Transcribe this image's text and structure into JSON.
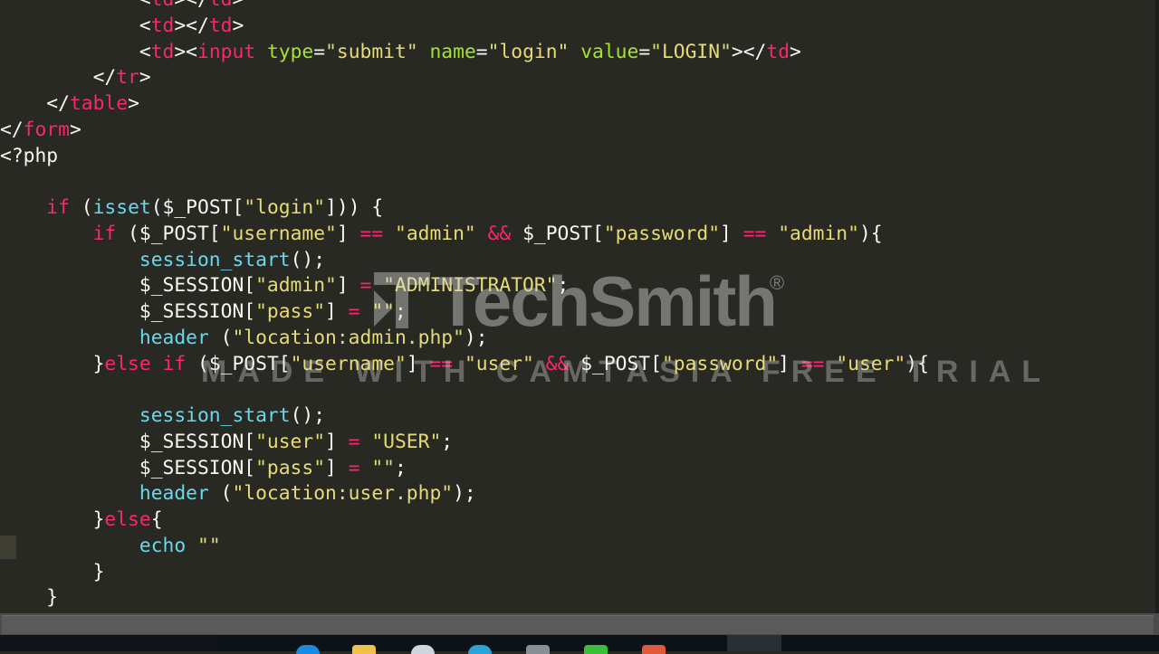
{
  "code_lines": [
    [
      {
        "t": "            ",
        "c": "plain"
      },
      {
        "t": "<",
        "c": "plain"
      },
      {
        "t": "td",
        "c": "tag"
      },
      {
        "t": "></",
        "c": "plain"
      },
      {
        "t": "td",
        "c": "tag"
      },
      {
        "t": ">",
        "c": "plain"
      }
    ],
    [
      {
        "t": "            ",
        "c": "plain"
      },
      {
        "t": "<",
        "c": "plain"
      },
      {
        "t": "td",
        "c": "tag"
      },
      {
        "t": "></",
        "c": "plain"
      },
      {
        "t": "td",
        "c": "tag"
      },
      {
        "t": ">",
        "c": "plain"
      }
    ],
    [
      {
        "t": "            ",
        "c": "plain"
      },
      {
        "t": "<",
        "c": "plain"
      },
      {
        "t": "td",
        "c": "tag"
      },
      {
        "t": "><",
        "c": "plain"
      },
      {
        "t": "input",
        "c": "tag"
      },
      {
        "t": " ",
        "c": "plain"
      },
      {
        "t": "type",
        "c": "attr"
      },
      {
        "t": "=",
        "c": "plain"
      },
      {
        "t": "\"submit\"",
        "c": "str"
      },
      {
        "t": " ",
        "c": "plain"
      },
      {
        "t": "name",
        "c": "attr"
      },
      {
        "t": "=",
        "c": "plain"
      },
      {
        "t": "\"login\"",
        "c": "str"
      },
      {
        "t": " ",
        "c": "plain"
      },
      {
        "t": "value",
        "c": "attr"
      },
      {
        "t": "=",
        "c": "plain"
      },
      {
        "t": "\"LOGIN\"",
        "c": "str"
      },
      {
        "t": "></",
        "c": "plain"
      },
      {
        "t": "td",
        "c": "tag"
      },
      {
        "t": ">",
        "c": "plain"
      }
    ],
    [
      {
        "t": "        ",
        "c": "plain"
      },
      {
        "t": "</",
        "c": "plain"
      },
      {
        "t": "tr",
        "c": "tag"
      },
      {
        "t": ">",
        "c": "plain"
      }
    ],
    [
      {
        "t": "    ",
        "c": "plain"
      },
      {
        "t": "</",
        "c": "plain"
      },
      {
        "t": "table",
        "c": "tag"
      },
      {
        "t": ">",
        "c": "plain"
      }
    ],
    [
      {
        "t": "</",
        "c": "plain"
      },
      {
        "t": "form",
        "c": "tag"
      },
      {
        "t": ">",
        "c": "plain"
      }
    ],
    [
      {
        "t": "<?php",
        "c": "plain"
      }
    ],
    [
      {
        "t": "",
        "c": "plain"
      }
    ],
    [
      {
        "t": "    ",
        "c": "plain"
      },
      {
        "t": "if",
        "c": "kw"
      },
      {
        "t": " (",
        "c": "plain"
      },
      {
        "t": "isset",
        "c": "fn"
      },
      {
        "t": "($_POST[",
        "c": "plain"
      },
      {
        "t": "\"login\"",
        "c": "str"
      },
      {
        "t": "])) {",
        "c": "plain"
      }
    ],
    [
      {
        "t": "        ",
        "c": "plain"
      },
      {
        "t": "if",
        "c": "kw"
      },
      {
        "t": " ($_POST[",
        "c": "plain"
      },
      {
        "t": "\"username\"",
        "c": "str"
      },
      {
        "t": "] ",
        "c": "plain"
      },
      {
        "t": "==",
        "c": "kw"
      },
      {
        "t": " ",
        "c": "plain"
      },
      {
        "t": "\"admin\"",
        "c": "str"
      },
      {
        "t": " ",
        "c": "plain"
      },
      {
        "t": "&&",
        "c": "kw"
      },
      {
        "t": " $_POST[",
        "c": "plain"
      },
      {
        "t": "\"password\"",
        "c": "str"
      },
      {
        "t": "] ",
        "c": "plain"
      },
      {
        "t": "==",
        "c": "kw"
      },
      {
        "t": " ",
        "c": "plain"
      },
      {
        "t": "\"admin\"",
        "c": "str"
      },
      {
        "t": "){",
        "c": "plain"
      }
    ],
    [
      {
        "t": "            ",
        "c": "plain"
      },
      {
        "t": "session_start",
        "c": "fn"
      },
      {
        "t": "();",
        "c": "plain"
      }
    ],
    [
      {
        "t": "            ",
        "c": "plain"
      },
      {
        "t": "$_SESSION[",
        "c": "plain"
      },
      {
        "t": "\"admin\"",
        "c": "str"
      },
      {
        "t": "] ",
        "c": "plain"
      },
      {
        "t": "=",
        "c": "kw"
      },
      {
        "t": " ",
        "c": "plain"
      },
      {
        "t": "\"ADMINISTRATOR\"",
        "c": "str"
      },
      {
        "t": ";",
        "c": "plain"
      }
    ],
    [
      {
        "t": "            ",
        "c": "plain"
      },
      {
        "t": "$_SESSION[",
        "c": "plain"
      },
      {
        "t": "\"pass\"",
        "c": "str"
      },
      {
        "t": "] ",
        "c": "plain"
      },
      {
        "t": "=",
        "c": "kw"
      },
      {
        "t": " ",
        "c": "plain"
      },
      {
        "t": "\"\"",
        "c": "str"
      },
      {
        "t": ";",
        "c": "plain"
      }
    ],
    [
      {
        "t": "            ",
        "c": "plain"
      },
      {
        "t": "header",
        "c": "fn"
      },
      {
        "t": " (",
        "c": "plain"
      },
      {
        "t": "\"location:admin.php\"",
        "c": "str"
      },
      {
        "t": ");",
        "c": "plain"
      }
    ],
    [
      {
        "t": "        ",
        "c": "plain"
      },
      {
        "t": "}",
        "c": "plain"
      },
      {
        "t": "else",
        "c": "kw"
      },
      {
        "t": " ",
        "c": "plain"
      },
      {
        "t": "if",
        "c": "kw"
      },
      {
        "t": " ($_POST[",
        "c": "plain"
      },
      {
        "t": "\"username\"",
        "c": "str"
      },
      {
        "t": "] ",
        "c": "plain"
      },
      {
        "t": "==",
        "c": "kw"
      },
      {
        "t": " ",
        "c": "plain"
      },
      {
        "t": "\"user\"",
        "c": "str"
      },
      {
        "t": " ",
        "c": "plain"
      },
      {
        "t": "&&",
        "c": "kw"
      },
      {
        "t": " $_POST[",
        "c": "plain"
      },
      {
        "t": "\"password\"",
        "c": "str"
      },
      {
        "t": "] ",
        "c": "plain"
      },
      {
        "t": "==",
        "c": "kw"
      },
      {
        "t": " ",
        "c": "plain"
      },
      {
        "t": "\"user\"",
        "c": "str"
      },
      {
        "t": "){",
        "c": "plain"
      }
    ],
    [
      {
        "t": "",
        "c": "plain"
      }
    ],
    [
      {
        "t": "            ",
        "c": "plain"
      },
      {
        "t": "session_start",
        "c": "fn"
      },
      {
        "t": "();",
        "c": "plain"
      }
    ],
    [
      {
        "t": "            ",
        "c": "plain"
      },
      {
        "t": "$_SESSION[",
        "c": "plain"
      },
      {
        "t": "\"user\"",
        "c": "str"
      },
      {
        "t": "] ",
        "c": "plain"
      },
      {
        "t": "=",
        "c": "kw"
      },
      {
        "t": " ",
        "c": "plain"
      },
      {
        "t": "\"USER\"",
        "c": "str"
      },
      {
        "t": ";",
        "c": "plain"
      }
    ],
    [
      {
        "t": "            ",
        "c": "plain"
      },
      {
        "t": "$_SESSION[",
        "c": "plain"
      },
      {
        "t": "\"pass\"",
        "c": "str"
      },
      {
        "t": "] ",
        "c": "plain"
      },
      {
        "t": "=",
        "c": "kw"
      },
      {
        "t": " ",
        "c": "plain"
      },
      {
        "t": "\"\"",
        "c": "str"
      },
      {
        "t": ";",
        "c": "plain"
      }
    ],
    [
      {
        "t": "            ",
        "c": "plain"
      },
      {
        "t": "header",
        "c": "fn"
      },
      {
        "t": " (",
        "c": "plain"
      },
      {
        "t": "\"location:user.php\"",
        "c": "str"
      },
      {
        "t": ");",
        "c": "plain"
      }
    ],
    [
      {
        "t": "        ",
        "c": "plain"
      },
      {
        "t": "}",
        "c": "plain"
      },
      {
        "t": "else",
        "c": "kw"
      },
      {
        "t": "{",
        "c": "plain"
      }
    ],
    [
      {
        "t": "            ",
        "c": "plain"
      },
      {
        "t": "echo",
        "c": "fn"
      },
      {
        "t": " ",
        "c": "plain"
      },
      {
        "t": "\"\"",
        "c": "str"
      }
    ],
    [
      {
        "t": "        ",
        "c": "plain"
      },
      {
        "t": "}",
        "c": "plain"
      }
    ],
    [
      {
        "t": "    ",
        "c": "plain"
      },
      {
        "t": "}",
        "c": "plain"
      }
    ]
  ],
  "watermark": {
    "brand": "TechSmith",
    "registered": "®",
    "made_with": "MADE WITH CAMTASIA FREE TRIAL"
  },
  "colors": {
    "background": "#282923",
    "tag": "#f92672",
    "attr": "#a6e22e",
    "string": "#e6db74",
    "function": "#66d9ef",
    "plain": "#f8f8f2"
  },
  "taskbar_icons": [
    "edge-icon",
    "file-explorer-icon",
    "people-icon",
    "browser-icon",
    "app-icon",
    "green-app-icon",
    "red-app-icon"
  ]
}
